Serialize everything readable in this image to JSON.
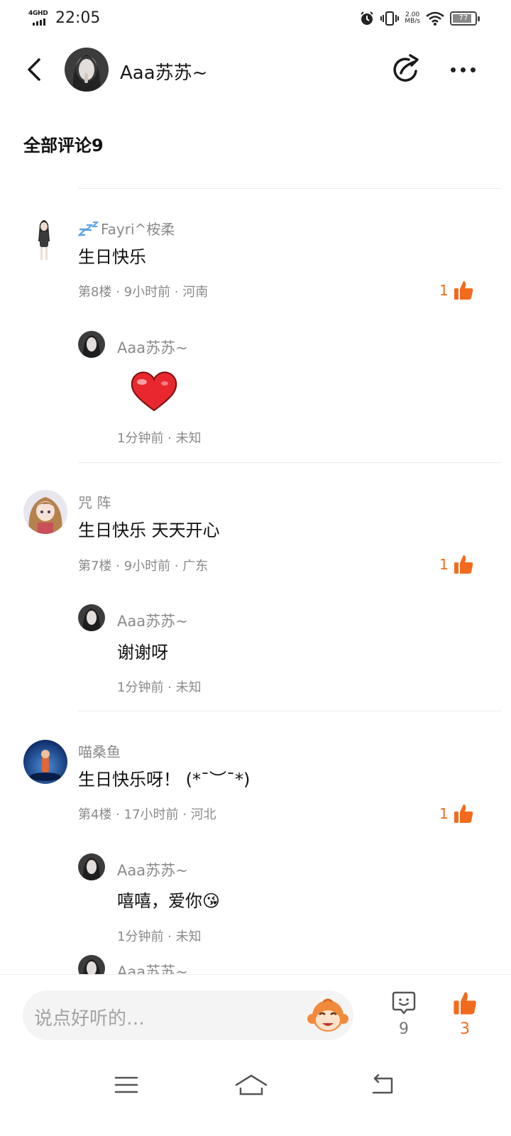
{
  "status_bar": {
    "network": "4GHD",
    "time": "22:05",
    "speed_value": "2.00",
    "speed_unit": "MB/s",
    "battery": "77"
  },
  "header": {
    "title": "Aaa苏苏~"
  },
  "comments_title": "全部评论9",
  "comments": [
    {
      "username": "Fayri^桉柔",
      "username_prefix_icon": "zzz-icon",
      "text": "生日快乐",
      "meta": "第8楼 · 9小时前 · 河南",
      "likes": "1",
      "reply": {
        "name": "Aaa苏苏~",
        "content_icon": "red-heart-icon",
        "meta": "1分钟前 · 未知"
      }
    },
    {
      "username": "咒 阵",
      "text": "生日快乐 天天开心",
      "meta": "第7楼 · 9小时前 · 广东",
      "likes": "1",
      "reply": {
        "name": "Aaa苏苏~",
        "text": "谢谢呀",
        "meta": "1分钟前 · 未知"
      }
    },
    {
      "username": "喵桑鱼",
      "text": "生日快乐呀！ (*ˉ︶ˉ*)",
      "meta": "第4楼 · 17小时前 · 河北",
      "likes": "1",
      "reply": {
        "name": "Aaa苏苏~",
        "text": "嘻嘻，爱你",
        "text_emoji": "😘",
        "meta": "1分钟前 · 未知"
      },
      "next_reply_name": "Aaa苏苏~"
    }
  ],
  "bottom_bar": {
    "input_placeholder": "说点好听的…",
    "comment_count": "9",
    "like_count": "3"
  },
  "colors": {
    "accent": "#f26b1d",
    "muted_text": "#8a8a8a",
    "divider": "#ebebeb"
  }
}
